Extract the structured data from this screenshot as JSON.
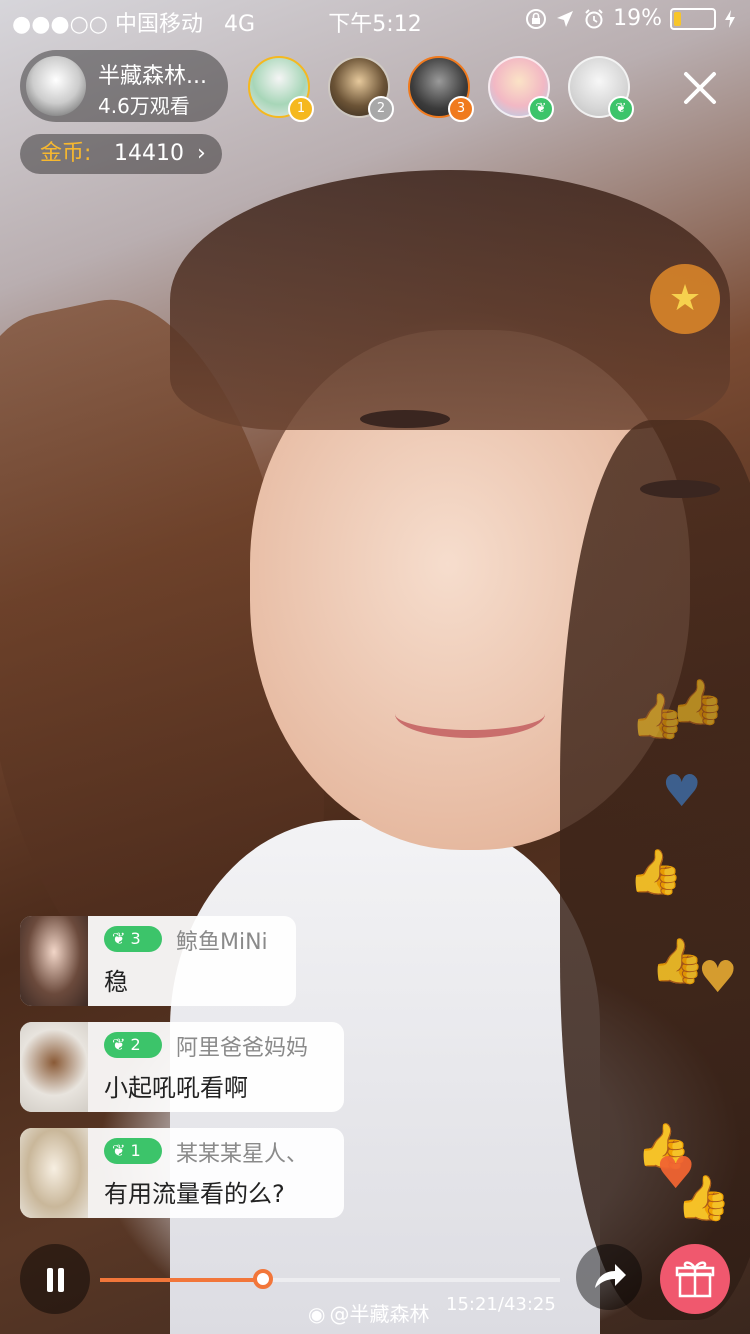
{
  "status_bar": {
    "carrier": "●●●○○ 中国移动",
    "network": "4G",
    "time": "下午5:12",
    "battery": "19%",
    "battery_level": 0.19,
    "icons": [
      "orientation-lock-icon",
      "location-arrow-icon",
      "alarm-icon",
      "battery-icon",
      "charging-bolt-icon"
    ]
  },
  "host": {
    "name": "半藏森林...",
    "viewers": "4.6万观看"
  },
  "coins": {
    "label": "金币:",
    "value": "14410",
    "chevron": "›"
  },
  "top_viewers": [
    {
      "rank": "1",
      "badge_color": "#f5b81f"
    },
    {
      "rank": "2",
      "badge_color": "#a8a8a8"
    },
    {
      "rank": "3",
      "badge_color": "#f07a1e"
    },
    {
      "rank": "",
      "badge_color": "#3cc46a"
    },
    {
      "rank": "",
      "badge_color": "#3cc46a"
    }
  ],
  "comments": [
    {
      "level": "3",
      "user": "鲸鱼MiNi",
      "message": "稳"
    },
    {
      "level": "2",
      "user": "阿里爸爸妈妈",
      "message": "小起吼吼看啊"
    },
    {
      "level": "1",
      "user": "某某某星人、",
      "message": "有用流量看的么?"
    }
  ],
  "player": {
    "progress": 0.355,
    "timecode": "15:21/43:25",
    "watermark": "@半藏森林"
  },
  "colors": {
    "accent": "#f2763a",
    "coins_label": "#f7b82f",
    "level_badge": "#3cc46a",
    "gift_button": "#f0586e"
  }
}
